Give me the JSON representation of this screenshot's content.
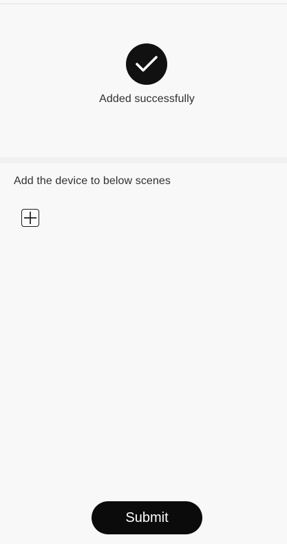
{
  "status": {
    "icon": "check-icon",
    "message": "Added successfully"
  },
  "scenes": {
    "label": "Add the device to below scenes",
    "add_icon": "plus-icon"
  },
  "footer": {
    "submit_label": "Submit"
  },
  "colors": {
    "background": "#f8f8f8",
    "accent": "#111111",
    "button_text": "#ffffff"
  }
}
